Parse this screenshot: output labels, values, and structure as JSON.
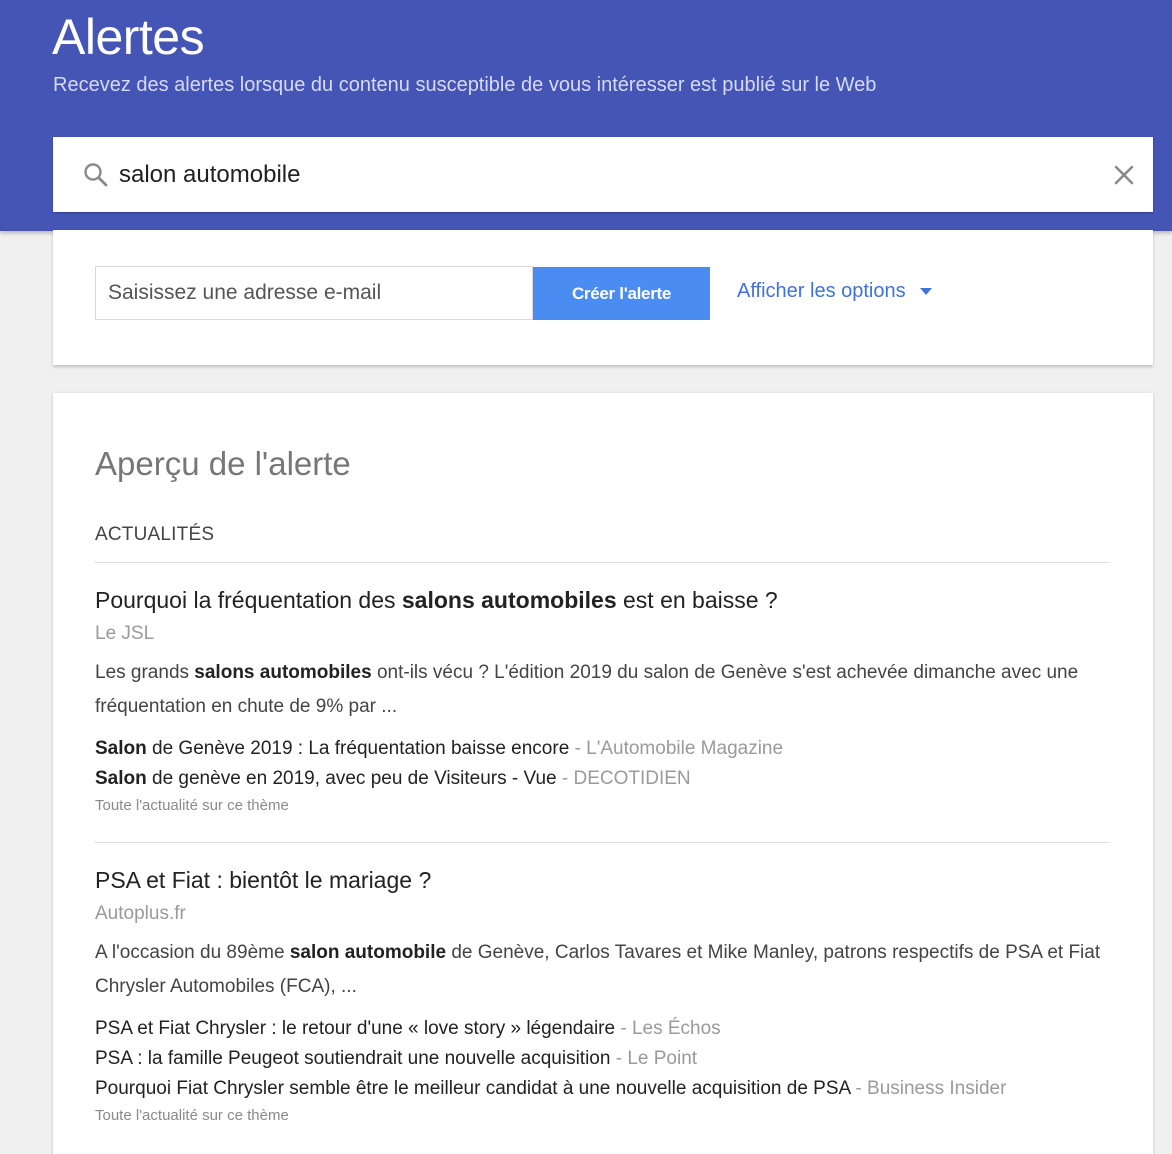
{
  "header": {
    "title": "Alertes",
    "subtitle": "Recevez des alertes lorsque du contenu susceptible de vous intéresser est publié sur le Web",
    "bg_color": "#4455b5"
  },
  "search": {
    "value": "salon automobile",
    "icon": "search-icon",
    "clear_icon": "close-icon"
  },
  "options": {
    "email_placeholder": "Saisissez une adresse e-mail",
    "create_label": "Créer l'alerte",
    "show_options_label": "Afficher les options",
    "accent": "#4a8cf1"
  },
  "preview": {
    "title": "Aperçu de l'alerte",
    "section_label": "ACTUALITÉS",
    "articles": [
      {
        "title_pre": "Pourquoi la fréquentation des ",
        "title_bold": "salons automobiles",
        "title_post": " est en baisse ?",
        "source": "Le JSL",
        "snippet_pre": "Les grands ",
        "snippet_bold": "salons automobiles",
        "snippet_post": " ont-ils vécu ? L'édition 2019 du salon de Genève s'est achevée dimanche avec une fréquentation en chute de 9% par ...",
        "related": [
          {
            "bold": "Salon",
            "text": " de Genève 2019 : La fréquentation baisse encore",
            "source": " - L'Automobile Magazine"
          },
          {
            "bold": "Salon",
            "text": " de genève en 2019, avec peu de Visiteurs - Vue",
            "source": " - DECOTIDIEN"
          }
        ],
        "theme_link": "Toute l'actualité sur ce thème"
      },
      {
        "title_pre": "PSA et Fiat : bientôt le mariage ?",
        "title_bold": "",
        "title_post": "",
        "source": "Autoplus.fr",
        "snippet_pre": "A l'occasion du 89ème ",
        "snippet_bold": "salon automobile",
        "snippet_post": " de Genève, Carlos Tavares et Mike Manley, patrons respectifs de PSA et Fiat Chrysler Automobiles (FCA), ...",
        "related": [
          {
            "bold": "",
            "text": "PSA et Fiat Chrysler : le retour d'une « love story » légendaire",
            "source": " - Les Échos"
          },
          {
            "bold": "",
            "text": "PSA : la famille Peugeot soutiendrait une nouvelle acquisition",
            "source": " - Le Point"
          },
          {
            "bold": "",
            "text": "Pourquoi Fiat Chrysler semble être le meilleur candidat à une nouvelle acquisition de PSA",
            "source": " - Business Insider"
          }
        ],
        "theme_link": "Toute l'actualité sur ce thème"
      }
    ]
  }
}
